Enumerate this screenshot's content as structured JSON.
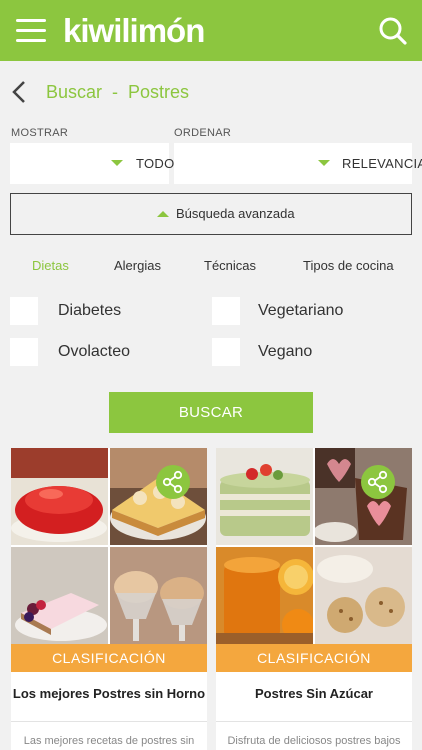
{
  "header": {
    "logo_text": "kiwilimón",
    "brand_color": "#8cc63f",
    "menu_icon": "hamburger-menu-icon",
    "search_icon": "search-icon"
  },
  "breadcrumb": {
    "back_icon": "chevron-left-icon",
    "text": "Buscar  -  Postres"
  },
  "filters": {
    "mostrar_label": "MOSTRAR",
    "mostrar_value": "TODO",
    "ordenar_label": "ORDENAR",
    "ordenar_value": "RELEVANCIA",
    "advanced_label": "Búsqueda avanzada"
  },
  "tabs": [
    {
      "label": "Dietas",
      "active": true
    },
    {
      "label": "Alergias",
      "active": false
    },
    {
      "label": "Técnicas",
      "active": false
    },
    {
      "label": "Tipos de cocina",
      "active": false
    }
  ],
  "options": [
    {
      "label": "Diabetes",
      "checked": false
    },
    {
      "label": "Vegetariano",
      "checked": false
    },
    {
      "label": "Ovolacteo",
      "checked": false
    },
    {
      "label": "Vegano",
      "checked": false
    }
  ],
  "search_button": "BUSCAR",
  "cards": [
    {
      "badge": "CLASIFICACIÓN",
      "title": "Los mejores Postres sin Horno",
      "description": "Las mejores recetas de postres sin",
      "share_icon": "share-icon"
    },
    {
      "badge": "CLASIFICACIÓN",
      "title": "Postres Sin Azúcar",
      "description": "Disfruta de deliciosos postres bajos",
      "share_icon": "share-icon"
    }
  ],
  "accent_orange": "#f4a73e"
}
